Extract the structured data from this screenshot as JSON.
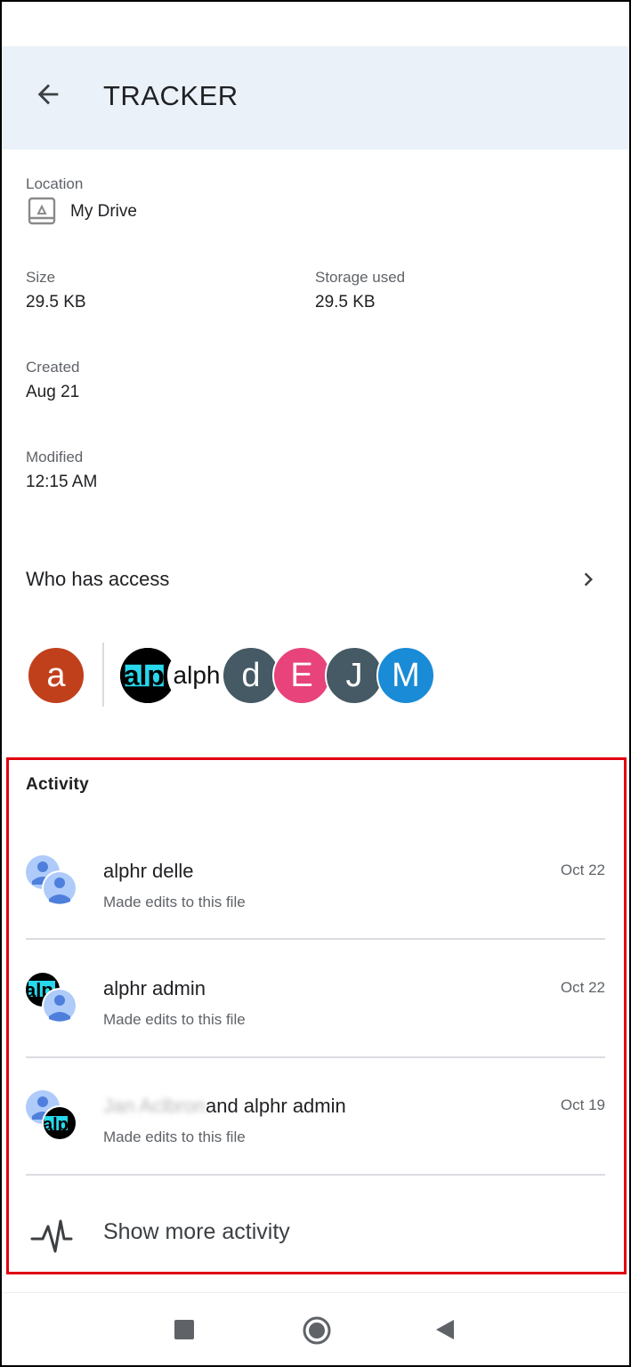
{
  "header": {
    "title": "TRACKER"
  },
  "details": {
    "location_label": "Location",
    "location_value": "My Drive",
    "size_label": "Size",
    "size_value": "29.5 KB",
    "storage_label": "Storage used",
    "storage_value": "29.5 KB",
    "created_label": "Created",
    "created_value": "Aug 21",
    "modified_label": "Modified",
    "modified_value": "12:15 AM"
  },
  "access": {
    "title": "Who has access",
    "owner_initial": "a",
    "shared": [
      {
        "label": "alph",
        "color": "#000000"
      },
      {
        "label": "d",
        "color": "#455a64"
      },
      {
        "label": "E",
        "color": "#e8437b"
      },
      {
        "label": "J",
        "color": "#455a64"
      },
      {
        "label": "M",
        "color": "#1a8bd6"
      }
    ],
    "owner_color": "#c1401c"
  },
  "activity": {
    "title": "Activity",
    "items": [
      {
        "name": "alphr delle",
        "desc": "Made edits to this file",
        "date": "Oct 22"
      },
      {
        "name": "alphr admin",
        "desc": "Made edits to this file",
        "date": "Oct 22"
      },
      {
        "name_blurred": "Jan Aclbron",
        "name_rest": "and alphr admin",
        "desc": "Made edits to this file",
        "date": "Oct 19"
      }
    ],
    "show_more": "Show more activity"
  },
  "colors": {
    "header_bg": "#ebf1f9",
    "highlight": "#e0000f",
    "cyan": "#27d8ec",
    "person_blue": "#8ab4f8"
  }
}
